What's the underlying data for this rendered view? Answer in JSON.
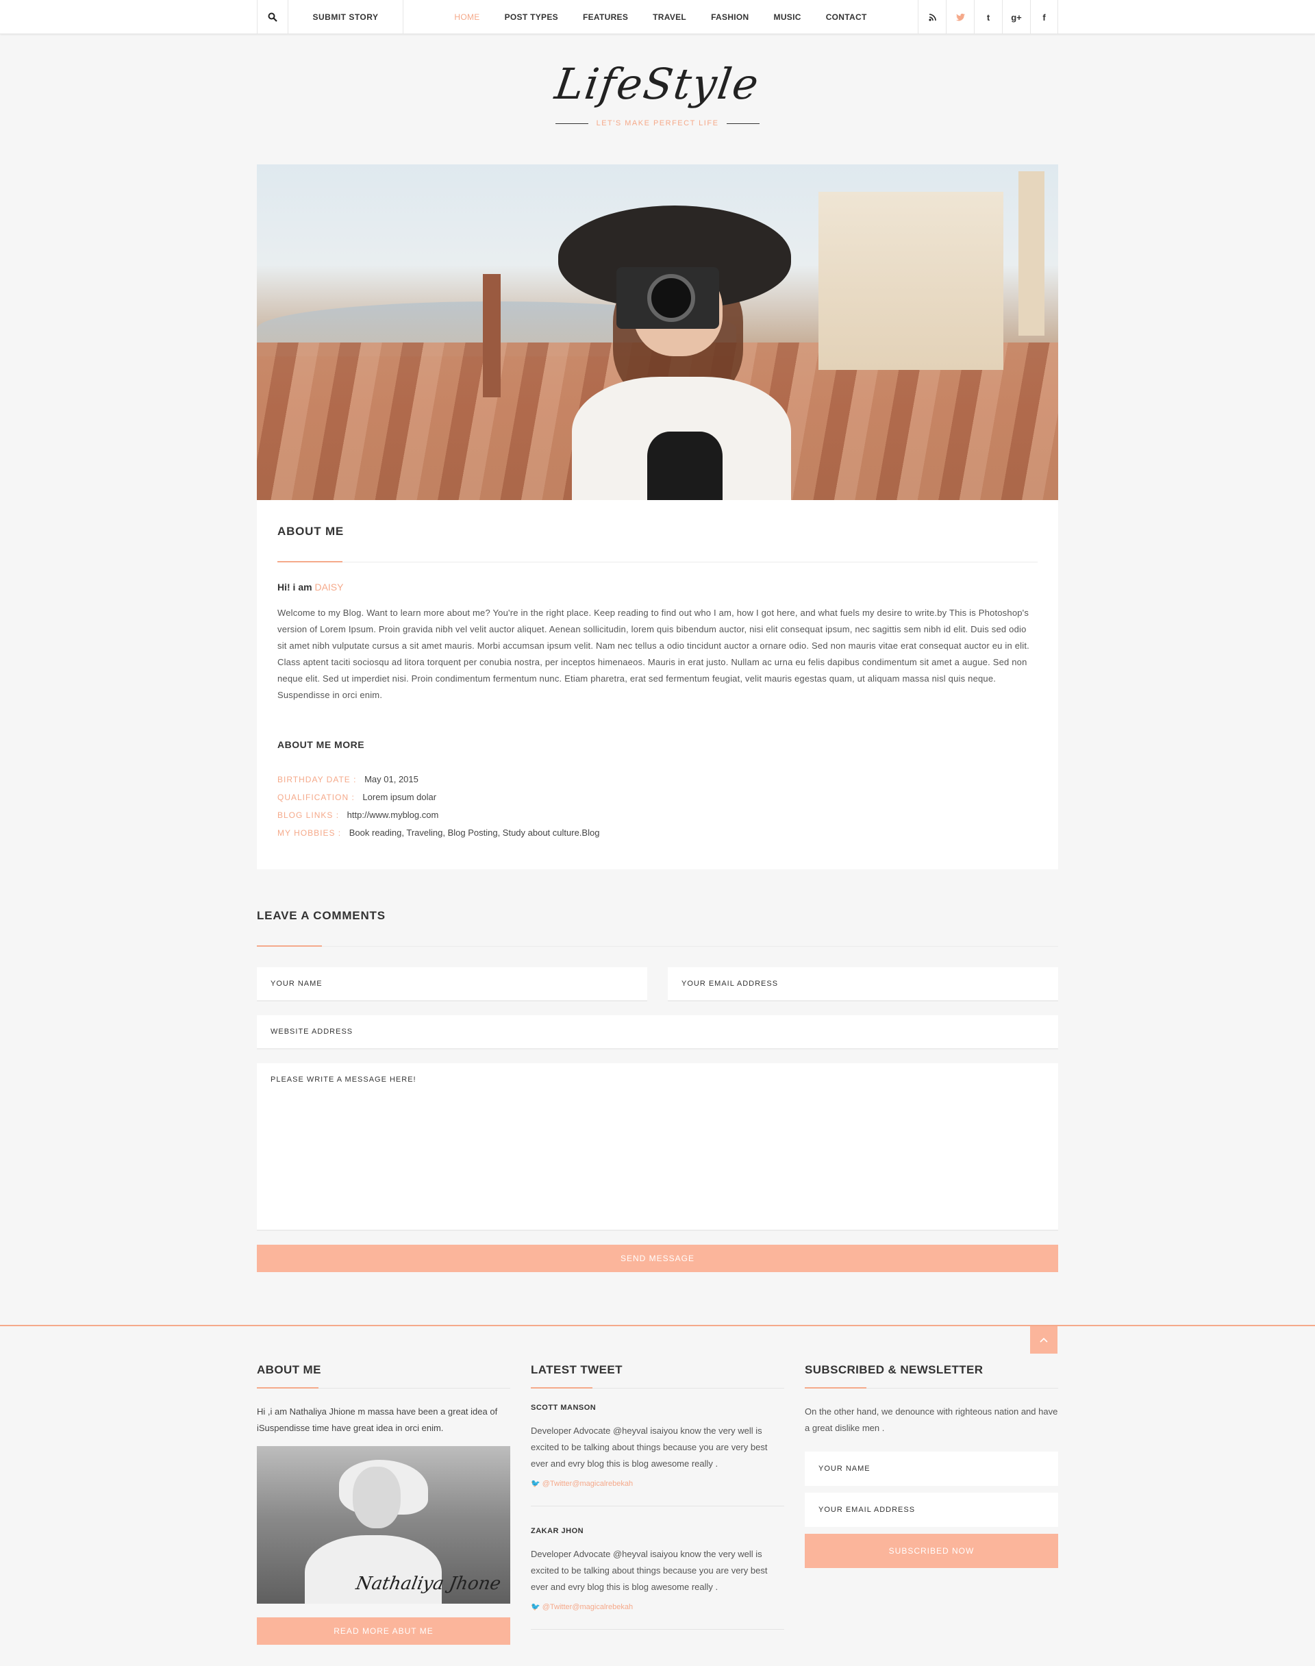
{
  "topbar": {
    "submit_label": "SUBMIT STORY",
    "nav": [
      "HOME",
      "POST TYPES",
      "FEATURES",
      "TRAVEL",
      "FASHION",
      "MUSIC",
      "CONTACT"
    ],
    "active_nav": "HOME",
    "social": {
      "rss": "⌁",
      "twitter": "🐦",
      "tumblr": "t",
      "gplus": "g+",
      "facebook": "f"
    }
  },
  "brand": {
    "logo": "LifeStyle",
    "tagline": "LET'S MAKE PERFECT LIFE",
    "accent": "#f5a98a"
  },
  "about": {
    "title": "ABOUT ME",
    "greeting": "Hi! i am",
    "name": "DAISY",
    "paragraph": "Welcome to my Blog. Want to learn more about me? You're in the right place. Keep reading to find out who I am, how I got here, and what fuels my desire to write.by This is Photoshop's version  of Lorem Ipsum. Proin gravida nibh vel velit auctor aliquet. Aenean sollicitudin, lorem quis bibendum auctor, nisi elit consequat ipsum, nec sagittis sem nibh id elit. Duis sed odio sit amet nibh vulputate cursus a sit amet mauris. Morbi accumsan ipsum velit. Nam nec tellus a odio tincidunt auctor a ornare odio. Sed non  mauris vitae erat consequat auctor eu in elit. Class aptent taciti sociosqu ad litora torquent per conubia nostra, per inceptos himenaeos. Mauris in erat justo. Nullam ac urna eu felis dapibus condimentum sit amet a augue. Sed non neque elit. Sed ut imperdiet nisi. Proin condimentum fermentum nunc. Etiam pharetra, erat sed fermentum feugiat, velit mauris egestas quam, ut aliquam massa nisl quis neque. Suspendisse in orci enim.",
    "more_title": "ABOUT ME MORE",
    "facts": [
      {
        "key": "BIRTHDAY  DATE :",
        "value": "May 01, 2015"
      },
      {
        "key": "QUALIFICATION :",
        "value": "Lorem ipsum dolar"
      },
      {
        "key": "BLOG LINKS   :",
        "value": "http://www.myblog.com"
      },
      {
        "key": "MY HOBBIES :",
        "value": "Book reading, Traveling, Blog Posting, Study about culture.Blog"
      }
    ]
  },
  "comments": {
    "title": "LEAVE A  COMMENTS",
    "name_placeholder": "YOUR NAME",
    "email_placeholder": "YOUR EMAIL ADDRESS",
    "website_placeholder": "WEBSITE ADDRESS",
    "message_placeholder": "PLEASE WRITE A MESSAGE HERE!",
    "submit_label": "SEND MESSAGE"
  },
  "footer": {
    "to_top": "⌃",
    "about": {
      "title": "ABOUT ME",
      "text": "Hi ,i am Nathaliya Jhione m massa have been a great idea of iSuspendisse time have great idea in orci enim.",
      "signature": "Nathaliya Jhone",
      "button": "READ MORE ABUT ME"
    },
    "tweets": {
      "title": "LATEST TWEET",
      "items": [
        {
          "author": "SCOTT MANSON",
          "body": "Developer Advocate @heyval isaiyou know the very well is excited to be talking about things because you are very best ever and evry blog this is blog awesome really .",
          "handle": "@Twitter@magicalrebekah"
        },
        {
          "author": "ZAKAR JHON",
          "body": "Developer Advocate @heyval isaiyou know the very well is excited to be talking about things because you are very best ever and evry blog this is blog awesome really .",
          "handle": "@Twitter@magicalrebekah"
        }
      ]
    },
    "newsletter": {
      "title": "SUBSCRIBED & NEWSLETTER",
      "text": "On the other hand, we denounce with righteous nation and have a great dislike men .",
      "name_placeholder": "YOUR NAME",
      "email_placeholder": "YOUR EMAIL ADDRESS",
      "button": "SUBSCRIBED NOW"
    }
  }
}
